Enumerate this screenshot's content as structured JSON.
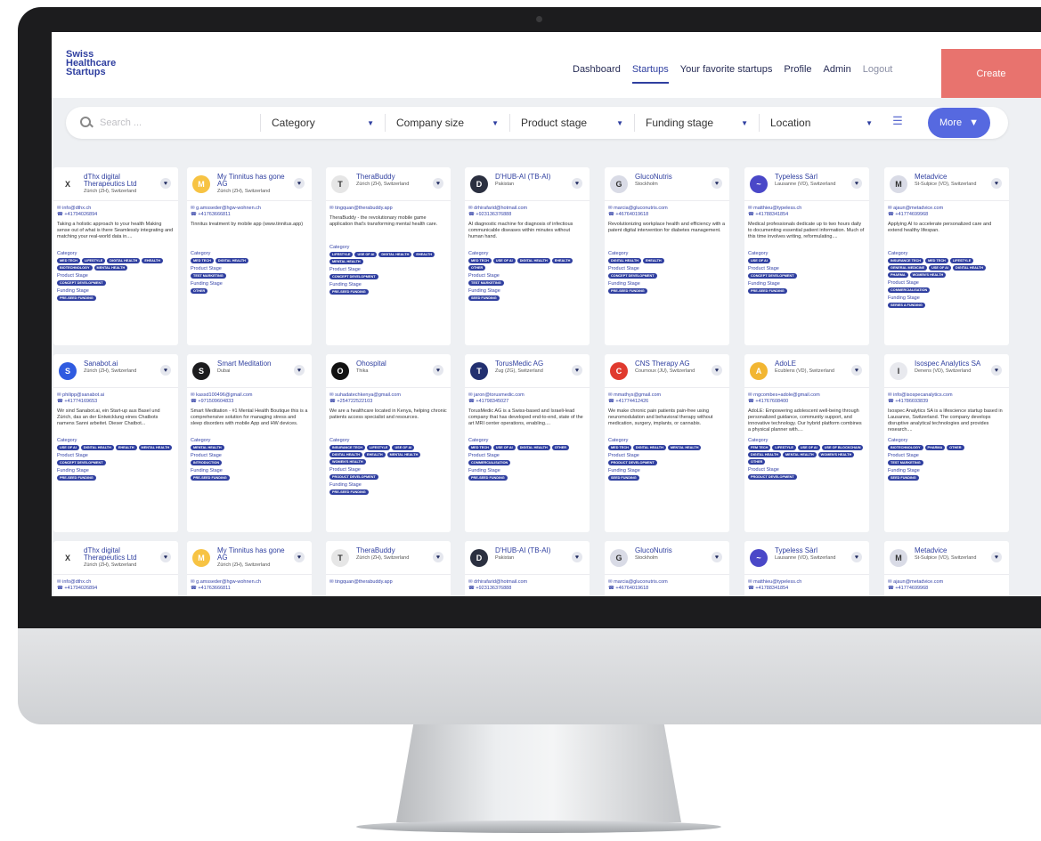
{
  "app": {
    "logo_line1": "Swiss",
    "logo_line2": "Healthcare",
    "logo_line3": "Startups"
  },
  "nav": [
    "Dashboard",
    "Startups",
    "Your favorite startups",
    "Profile",
    "Admin",
    "Logout"
  ],
  "create_label": "Create",
  "filters": {
    "search_placeholder": "Search ...",
    "items": [
      "Category",
      "Company size",
      "Product stage",
      "Funding stage",
      "Location"
    ],
    "more_label": "More"
  },
  "cards": [
    {
      "name": "dThx digital Therapeutics Ltd",
      "loc": "Zürich (ZH), Switzerland",
      "email": "info@dthx.ch",
      "phone": "+41794026894",
      "desc": "Taking a holistic approach to your health Making sense out of what is there Seamlessly integrating and matching your real-world data in....",
      "cat": [
        "MED TECH",
        "LIFESTYLE",
        "DIGITAL HEALTH",
        "EHEALTH",
        "BIOTECHNOLOGY",
        "MENTAL HEALTH"
      ],
      "stage": [
        "CONCEPT DEVELOPMENT"
      ],
      "fund": [
        "PRE-SEED FUNDING"
      ],
      "av": "X",
      "color": "#ffffff"
    },
    {
      "name": "My Tinnitus has gone AG",
      "loc": "Zürich (ZH), Switzerland",
      "email": "g.amsseder@hgw-wohnen.ch",
      "phone": "+41763666811",
      "desc": "Tinnitus treatment by mobile app (www.tinnitus.app)",
      "cat": [
        "MED TECH",
        "DIGITAL HEALTH"
      ],
      "stage": [
        "TEST MARKETING"
      ],
      "fund": [
        "OTHER"
      ],
      "av": "M",
      "color": "#f7c343"
    },
    {
      "name": "TheraBuddy",
      "loc": "Zürich (ZH), Switzerland",
      "email": "tingquan@therabuddy.app",
      "phone": "",
      "desc": "TheraBuddy - the revolutionary mobile game application that's transforming mental health care.",
      "cat": [
        "LIFESTYLE",
        "USE OF AI",
        "DIGITAL HEALTH",
        "EHEALTH",
        "MENTAL HEALTH"
      ],
      "stage": [
        "CONCEPT DEVELOPMENT"
      ],
      "fund": [
        "PRE-SEED FUNDING"
      ],
      "av": "T",
      "color": "#e6e6e6"
    },
    {
      "name": "D'HUB-AI (TB-AI)",
      "loc": "Pakistan",
      "email": "drhirafarid@hotmail.com",
      "phone": "+923136376888",
      "desc": "AI diagnostic machine for diagnosis of infectious communicable diseases within minutes without human hand.",
      "cat": [
        "MED TECH",
        "USE OF AI",
        "DIGITAL HEALTH",
        "EHEALTH",
        "OTHER"
      ],
      "stage": [
        "TEST MARKETING"
      ],
      "fund": [
        "SEED FUNDING"
      ],
      "av": "D",
      "color": "#2b3040"
    },
    {
      "name": "GlucoNutris",
      "loc": "Stockholm",
      "email": "marcia@gluconutris.com",
      "phone": "+46764019618",
      "desc": "Revolutionizing workplace health and efficiency with a patent digital intervention for diabetes management.",
      "cat": [
        "DIGITAL HEALTH",
        "EHEALTH"
      ],
      "stage": [
        "CONCEPT DEVELOPMENT"
      ],
      "fund": [
        "PRE-SEED FUNDING"
      ],
      "av": "G",
      "color": "#d9dbe6"
    },
    {
      "name": "Typeless Sàrl",
      "loc": "Lausanne (VD), Switzerland",
      "email": "matthieu@typeless.ch",
      "phone": "+41788341854",
      "desc": "Medical professionals dedicate up to two hours daily to documenting essential patient information. Much of this time involves writing, reformulating....",
      "cat": [
        "USE OF AI"
      ],
      "stage": [
        "CONCEPT DEVELOPMENT"
      ],
      "fund": [
        "PRE-SEED FUNDING"
      ],
      "av": "~",
      "color": "#4a48c8"
    },
    {
      "name": "Metadvice",
      "loc": "St-Sulpice (VD), Switzerland",
      "email": "ajaun@metadvice.com",
      "phone": "+41774699968",
      "desc": "Applying AI to accelerate personalized care and extend healthy lifespan.",
      "cat": [
        "INSURANCE TECH",
        "MED TECH",
        "LIFESTYLE",
        "GENERAL MEDICINE",
        "USE OF AI",
        "DIGITAL HEALTH",
        "PHARMA",
        "WOMEN'S HEALTH"
      ],
      "stage": [
        "COMMERCIALISATION"
      ],
      "fund": [
        "SERIES A FUNDING"
      ],
      "av": "M",
      "color": "#d9dbe6"
    },
    {
      "name": "Sanabot.ai",
      "loc": "Zürich (ZH), Switzerland",
      "email": "philipp@sanabot.ai",
      "phone": "+41774169653",
      "desc": "Wir sind Sanabot.ai, ein Start-up aus Basel und Zürich, das an der Entwicklung eines Chatbots namens Sanni arbeitet. Dieser Chatbot...",
      "cat": [
        "USE OF AI",
        "DIGITAL HEALTH",
        "EHEALTH",
        "MENTAL HEALTH"
      ],
      "stage": [
        "CONCEPT DEVELOPMENT"
      ],
      "fund": [
        "PRE-SEED FUNDING"
      ],
      "av": "S",
      "color": "#2f5be0"
    },
    {
      "name": "Smart Meditation",
      "loc": "Dubai",
      "email": "kassd100496@gmail.com",
      "phone": "+971509604833",
      "desc": "Smart Meditation - #1 Mental Health Boutique this is a comprehensive solution for managing stress and sleep disorders with mobile App and HW devices.",
      "cat": [
        "MENTAL HEALTH"
      ],
      "stage": [
        "INTRODUCTION"
      ],
      "fund": [
        "PRE-SEED FUNDING"
      ],
      "av": "S",
      "color": "#1c1c1e"
    },
    {
      "name": "Ohospital",
      "loc": "Thika",
      "email": "suhadatechkenya@gmail.com",
      "phone": "+254722522103",
      "desc": "We are a healthcare located in Kenya, helping chronic patients access specialist and resources.",
      "cat": [
        "INSURANCE TECH",
        "LIFESTYLE",
        "USE OF AI",
        "DIGITAL HEALTH",
        "EHEALTH",
        "MENTAL HEALTH",
        "WOMEN'S HEALTH"
      ],
      "stage": [
        "PRODUCT DEVELOPMENT"
      ],
      "fund": [
        "PRE-SEED FUNDING"
      ],
      "av": "O",
      "color": "#111111"
    },
    {
      "name": "TorusMedic AG",
      "loc": "Zug (ZG), Switzerland",
      "email": "jaron@torusmedic.com",
      "phone": "+41798345027",
      "desc": "TorusMedic AG is a Swiss-based and Israeli-lead company that has developed end-to-end, state of the art MRI center operations, enabling....",
      "cat": [
        "MED TECH",
        "USE OF AI",
        "DIGITAL HEALTH",
        "OTHER"
      ],
      "stage": [
        "COMMERCIALISATION"
      ],
      "fund": [
        "PRE-SEED FUNDING"
      ],
      "av": "T",
      "color": "#223070"
    },
    {
      "name": "CNS Therapy AG",
      "loc": "Cournoux (JU), Switzerland",
      "email": "mmathys@gmail.com",
      "phone": "+41774412426",
      "desc": "We make chronic pain patients pain-free using neuromodulation and behavioral therapy without medication, surgery, implants, or cannabis.",
      "cat": [
        "MED TECH",
        "DIGITAL HEALTH",
        "MENTAL HEALTH"
      ],
      "stage": [
        "PRODUCT DEVELOPMENT"
      ],
      "fund": [
        "SEED FUNDING"
      ],
      "av": "C",
      "color": "#e03a2e"
    },
    {
      "name": "AdoLE",
      "loc": "Ecublens (VD), Switzerland",
      "email": "rngcombes+adole@gmail.com",
      "phone": "+41767608400",
      "desc": "AdoLE: Empowering adolescent well-being through personalized guidance, community support, and innovative technology. Our hybrid platform combines a physical planner with....",
      "cat": [
        "FEM TECH",
        "LIFESTYLE",
        "USE OF AI",
        "USE OF BLOCKCHAIN",
        "DIGITAL HEALTH",
        "MENTAL HEALTH",
        "WOMEN'S HEALTH",
        "OTHER"
      ],
      "stage": [
        "PRODUCT DEVELOPMENT"
      ],
      "fund": [],
      "av": "A",
      "color": "#f2b632"
    },
    {
      "name": "Isospec Analytics SA",
      "loc": "Denens (VD), Switzerland",
      "email": "info@isospecanalytics.com",
      "phone": "+41786693839",
      "desc": "Isospec Analytics SA is a lifescience startup based in Lausanne, Switzerland. The company develops disruptive analytical technologies and provides research....",
      "cat": [
        "BIOTECHNOLOGY",
        "PHARMA",
        "OTHER"
      ],
      "stage": [
        "TEST MARKETING"
      ],
      "fund": [
        "SEED FUNDING"
      ],
      "av": "I",
      "color": "#e8e9ee"
    }
  ],
  "labels": {
    "category": "Category",
    "product_stage": "Product Stage",
    "funding_stage": "Funding Stage"
  }
}
